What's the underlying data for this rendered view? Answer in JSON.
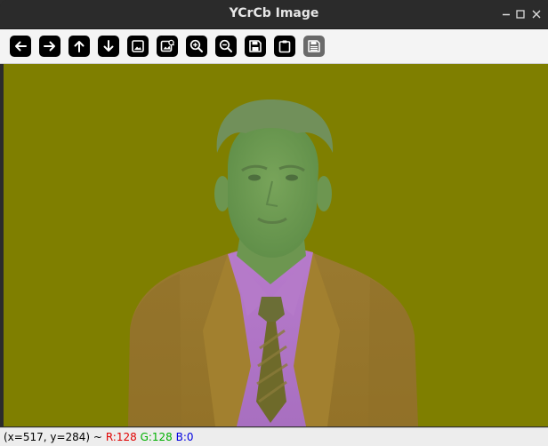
{
  "window": {
    "title": "YCrCb Image"
  },
  "toolbar": {
    "buttons": [
      {
        "name": "arrow-left-icon",
        "label": "Pan left"
      },
      {
        "name": "arrow-right-icon",
        "label": "Pan right"
      },
      {
        "name": "arrow-up-icon",
        "label": "Pan up"
      },
      {
        "name": "arrow-down-icon",
        "label": "Pan down"
      },
      {
        "name": "zoom-fit-icon",
        "label": "Zoom fit"
      },
      {
        "name": "image-info-icon",
        "label": "Image info"
      },
      {
        "name": "zoom-in-icon",
        "label": "Zoom in"
      },
      {
        "name": "zoom-out-icon",
        "label": "Zoom out"
      },
      {
        "name": "save-icon",
        "label": "Save"
      },
      {
        "name": "clipboard-icon",
        "label": "Copy to clipboard"
      },
      {
        "name": "properties-icon",
        "label": "Properties"
      }
    ]
  },
  "status": {
    "coords": "(x=517, y=284) ~",
    "r": "R:128",
    "g": "G:128",
    "b": "B:0"
  },
  "colors": {
    "canvas_background": "#7f7f00",
    "figure_suit": "#9a7a2e",
    "figure_skin": "#6f9a52",
    "figure_shirt": "#b277c9",
    "status_r": "#e00000",
    "status_g": "#00b000",
    "status_b": "#0000e0"
  }
}
